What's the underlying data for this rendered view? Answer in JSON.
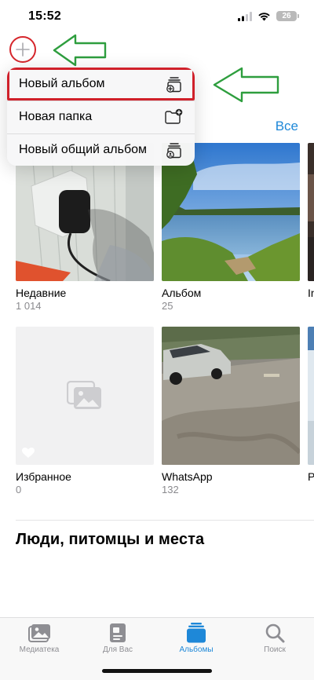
{
  "status_bar": {
    "time": "15:52",
    "battery": "26"
  },
  "menu": {
    "items": [
      {
        "label": "Новый альбом",
        "icon": "new-album-icon"
      },
      {
        "label": "Новая папка",
        "icon": "new-folder-icon"
      },
      {
        "label": "Новый общий альбом",
        "icon": "shared-album-icon"
      }
    ]
  },
  "my_albums": {
    "see_all": "Все"
  },
  "albums": [
    {
      "name": "Недавние",
      "count": "1 014"
    },
    {
      "name": "Альбом",
      "count": "25"
    },
    {
      "name": "In",
      "count": ""
    },
    {
      "name": "Избранное",
      "count": "0"
    },
    {
      "name": "WhatsApp",
      "count": "132"
    },
    {
      "name": "P",
      "count": ""
    }
  ],
  "sections": {
    "people_places": "Люди, питомцы и места"
  },
  "tabs": [
    {
      "label": "Медиатека",
      "icon": "photo-library-icon"
    },
    {
      "label": "Для Вас",
      "icon": "for-you-icon"
    },
    {
      "label": "Альбомы",
      "icon": "albums-icon",
      "active": true
    },
    {
      "label": "Поиск",
      "icon": "search-icon"
    }
  ],
  "colors": {
    "accent": "#1e88d8",
    "annotation_red": "#d0202a",
    "annotation_green": "#2e9e3e"
  }
}
